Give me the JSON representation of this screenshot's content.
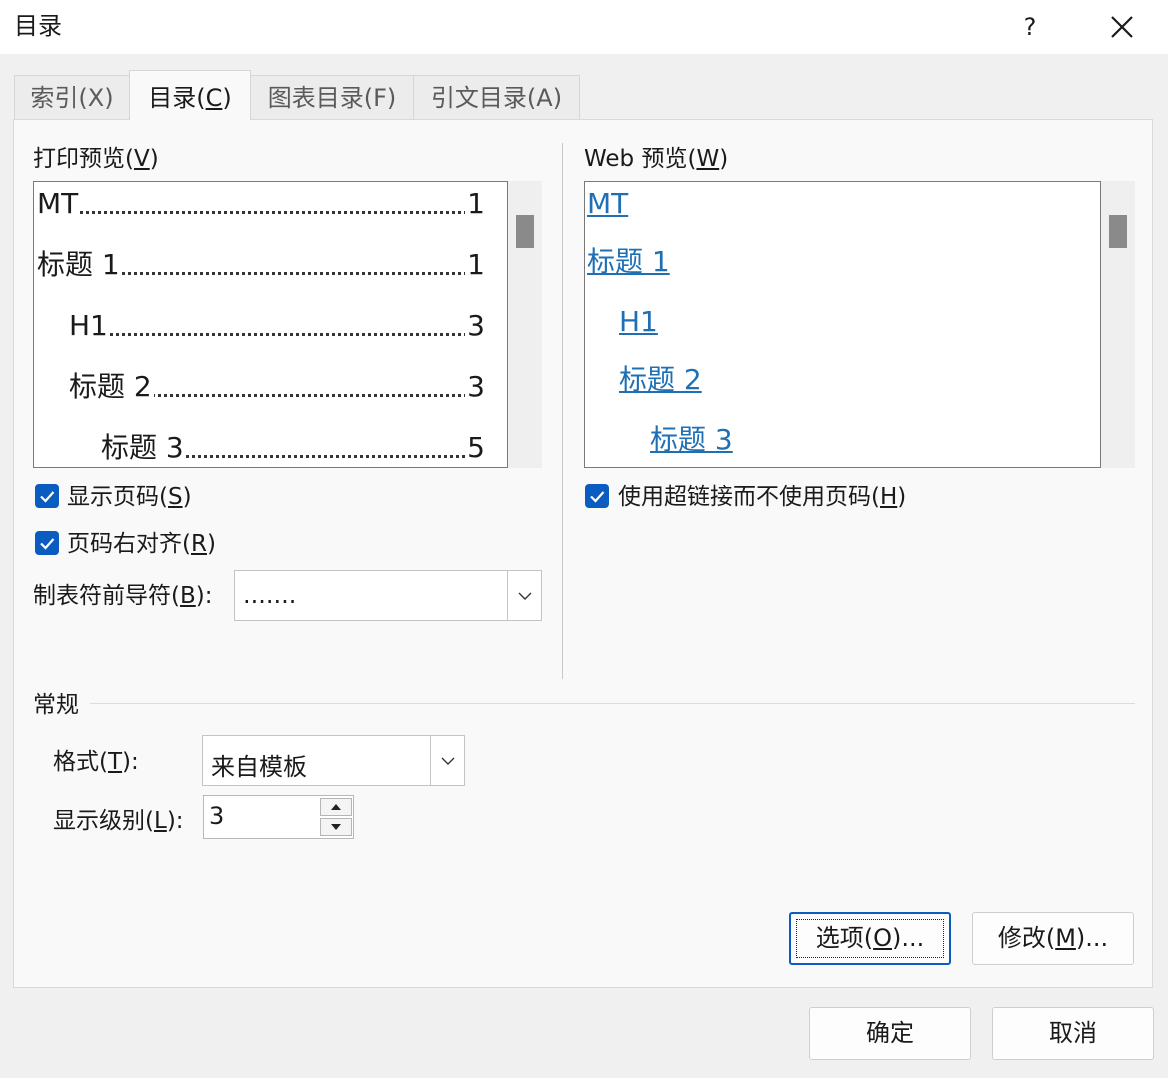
{
  "window": {
    "title": "目录",
    "help": "?"
  },
  "tabs": [
    {
      "label": "索引(X)"
    },
    {
      "label": "目录(",
      "accel": "C",
      "suffix": ")"
    },
    {
      "label": "图表目录(F)"
    },
    {
      "label": "引文目录(A)"
    }
  ],
  "print_preview": {
    "label": "打印预览(",
    "accel": "V",
    "suffix": ")",
    "entries": [
      {
        "text": "MT",
        "page": "1"
      },
      {
        "text": "标题  1",
        "page": "1"
      },
      {
        "text": "H1",
        "page": "3"
      },
      {
        "text": "标题  2",
        "page": "3"
      },
      {
        "text": "标题  3",
        "page": "5"
      }
    ]
  },
  "web_preview": {
    "label": "Web 预览(",
    "accel": "W",
    "suffix": ")",
    "entries": [
      "MT",
      "标题  1",
      "H1",
      "标题  2",
      "标题  3"
    ]
  },
  "options": {
    "show_page_numbers": {
      "label": "显示页码(",
      "accel": "S",
      "suffix": ")",
      "checked": true
    },
    "right_align": {
      "label": "页码右对齐(",
      "accel": "R",
      "suffix": ")",
      "checked": true
    },
    "tab_leader": {
      "label": "制表符前导符(",
      "accel": "B",
      "suffix": "):",
      "value": "......."
    },
    "use_hyperlinks": {
      "label": "使用超链接而不使用页码(",
      "accel": "H",
      "suffix": ")",
      "checked": true
    }
  },
  "general": {
    "heading": "常规",
    "format": {
      "label": "格式(",
      "accel": "T",
      "suffix": "):",
      "value": "来自模板"
    },
    "levels": {
      "label": "显示级别(",
      "accel": "L",
      "suffix": "):",
      "value": "3"
    }
  },
  "buttons": {
    "options": {
      "label": "选项(",
      "accel": "O",
      "suffix": ")..."
    },
    "modify": {
      "label": "修改(",
      "accel": "M",
      "suffix": ")..."
    },
    "ok": "确定",
    "cancel": "取消"
  },
  "colors": {
    "accent": "#0b5cc1",
    "link": "#1f6fb5"
  }
}
